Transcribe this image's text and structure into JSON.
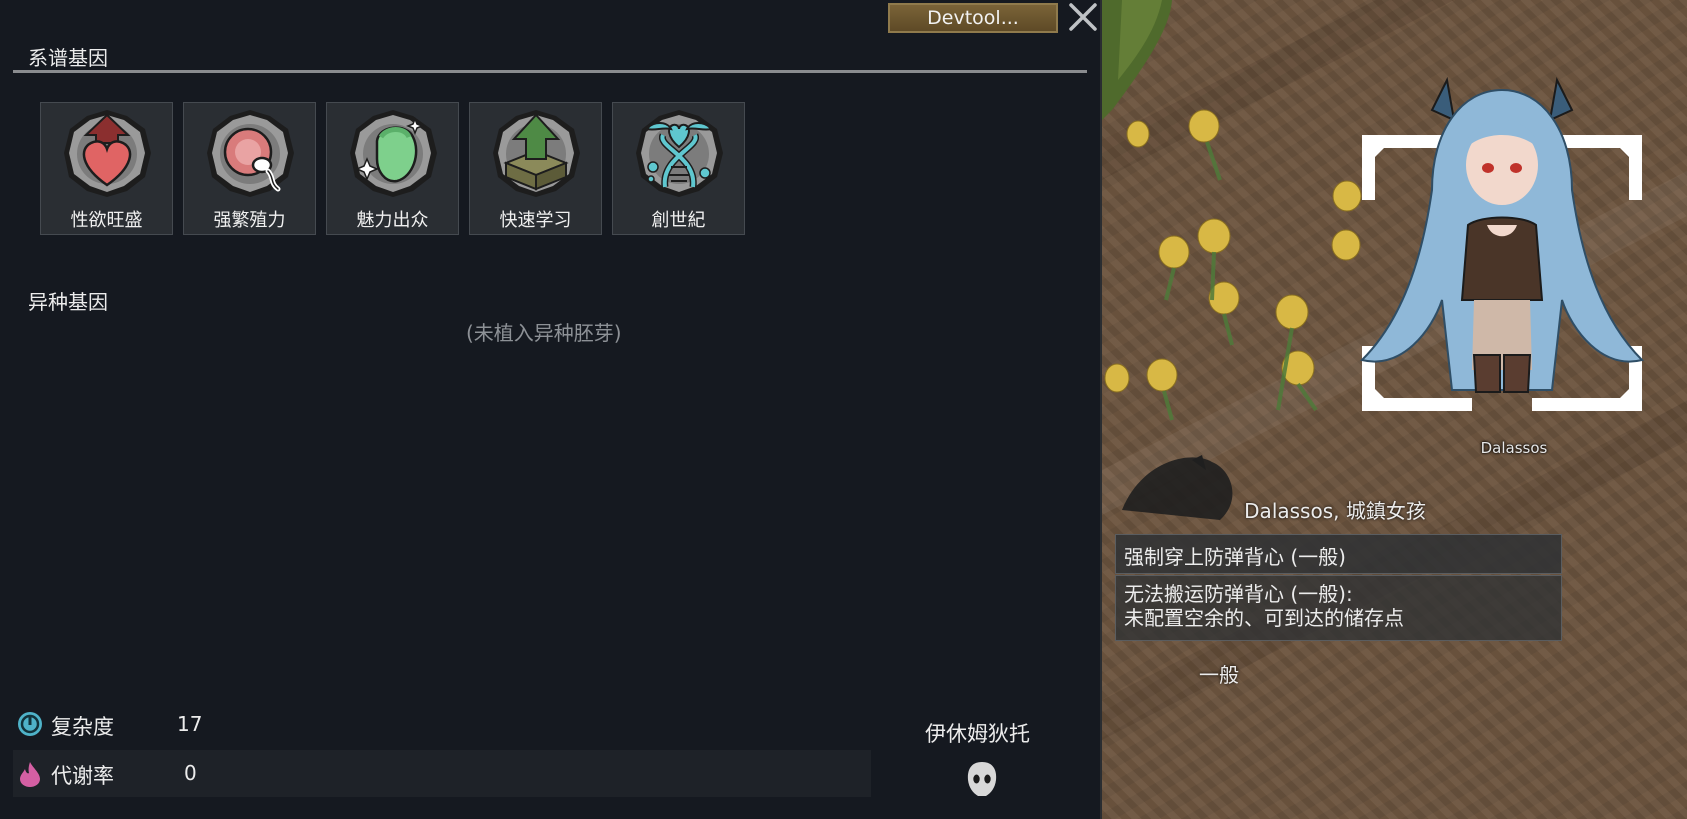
{
  "toolbar": {
    "devtool_label": "Devtool...",
    "close_icon": "close-icon"
  },
  "germline_genes": {
    "title": "系谱基因",
    "items": [
      {
        "label": "性欲旺盛",
        "icon": "heart-up-arrow-icon"
      },
      {
        "label": "强繁殖力",
        "icon": "sperm-egg-icon"
      },
      {
        "label": "魅力出众",
        "icon": "sparkle-face-icon"
      },
      {
        "label": "快速学习",
        "icon": "box-up-arrow-icon"
      },
      {
        "label": "創世紀",
        "icon": "dna-heart-icon"
      }
    ]
  },
  "xenogenes": {
    "title": "异种基因",
    "empty_text": "(未植入异种胚芽)"
  },
  "stats": {
    "complexity": {
      "label": "复杂度",
      "value": "17",
      "icon": "complexity-icon",
      "color": "#4fb3c9"
    },
    "metabolism": {
      "label": "代谢率",
      "value": "0",
      "icon": "metabolism-drop-icon",
      "color": "#d45fa3"
    }
  },
  "xenotype": {
    "name": "伊休姆狄托",
    "icon": "xenotype-skull-icon"
  },
  "map": {
    "pawn_name": "Dalassos",
    "context_menu": {
      "title": "Dalassos, 城鎮女孩",
      "items": [
        {
          "label": "强制穿上防弹背心 (一般)"
        },
        {
          "label_line1": "无法搬运防弹背心 (一般):",
          "label_line2": "未配置空余的、可到达的储存点"
        }
      ]
    },
    "apparel_label": "一般"
  }
}
